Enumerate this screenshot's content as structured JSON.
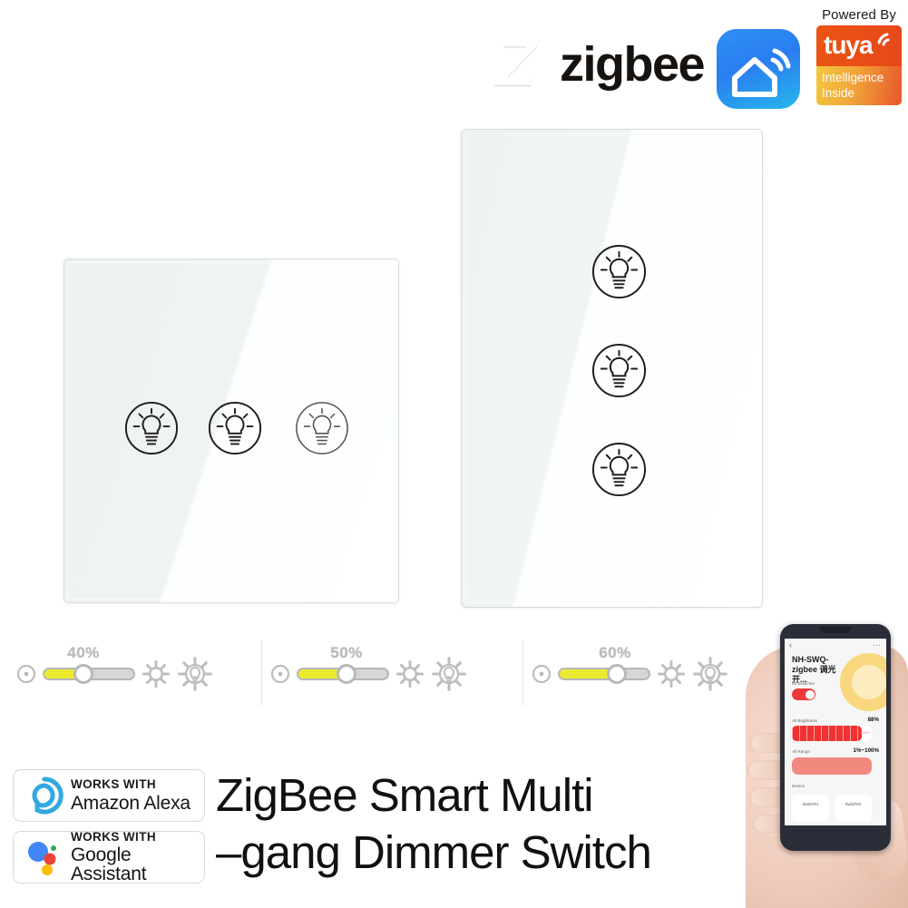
{
  "badges": {
    "zigbee": {
      "mark_letter": "Z",
      "wordmark": "zigbee",
      "brand_color": "#cf1217"
    },
    "smart_life": {
      "icon_name": "smart-home-app-icon",
      "brand_color": "#2a7ef0"
    },
    "tuya": {
      "powered_by": "Powered By",
      "wordmark": "tuya",
      "tagline_line1": "Intelligence",
      "tagline_line2": "Inside",
      "top_color": "#e8481a",
      "bottom_gradient_from": "#f3c73c",
      "bottom_gradient_to": "#e8562a"
    }
  },
  "panels": [
    {
      "name": "eu-3-gang-panel",
      "style": "EU square glass touch panel",
      "buttons": [
        {
          "icon": "light-bulb-icon",
          "label": "gang-1"
        },
        {
          "icon": "light-bulb-icon",
          "label": "gang-2"
        },
        {
          "icon": "light-bulb-icon",
          "label": "gang-3"
        }
      ]
    },
    {
      "name": "us-3-gang-panel",
      "style": "US vertical glass touch panel",
      "buttons": [
        {
          "icon": "light-bulb-icon",
          "label": "gang-1"
        },
        {
          "icon": "light-bulb-icon",
          "label": "gang-2"
        },
        {
          "icon": "light-bulb-icon",
          "label": "gang-3"
        }
      ]
    }
  ],
  "dimmers": [
    {
      "percent_label": "40%",
      "value": 40,
      "power_icon": "power-icon",
      "sun_icon": "brightness-sun-icon",
      "bulb_icon": "sun-bulb-icon"
    },
    {
      "percent_label": "50%",
      "value": 50,
      "power_icon": "power-icon",
      "sun_icon": "brightness-sun-icon",
      "bulb_icon": "sun-bulb-icon"
    },
    {
      "percent_label": "60%",
      "value": 60,
      "power_icon": "power-icon",
      "sun_icon": "brightness-sun-icon",
      "bulb_icon": "sun-bulb-icon"
    }
  ],
  "slider_colors": {
    "fill": "#ecea2f",
    "track": "#d6d6d6",
    "text": "#b9b9b9"
  },
  "compatibility": [
    {
      "works_with": "WORKS WITH",
      "brand": "Amazon Alexa",
      "icon": "alexa-logo-icon",
      "color": "#31a8e0"
    },
    {
      "works_with": "WORKS WITH",
      "brand": "Google Assistant",
      "icon": "google-assistant-logo-icon",
      "color": "#4285f4"
    }
  ],
  "product": {
    "title_line1": "ZigBee Smart Multi",
    "title_line2": "–gang Dimmer Switch"
  },
  "phone_app": {
    "back_icon": "back-chevron-icon",
    "more_icon": "more-dots-icon",
    "device_title": "NH-SWQ-zigbee 调光开...",
    "all_switches_label": "All Switches",
    "all_switches_state": "on",
    "all_brightness_label": "All Brightness",
    "all_brightness_value": "88%",
    "all_range_label": "All Range",
    "all_range_value": "1%~100%",
    "device_section_label": "Device",
    "devices": [
      {
        "name": "Switch#1"
      },
      {
        "name": "Switch#2"
      }
    ],
    "accent_color": "#f03232",
    "dial_color": "#f8d77e"
  }
}
